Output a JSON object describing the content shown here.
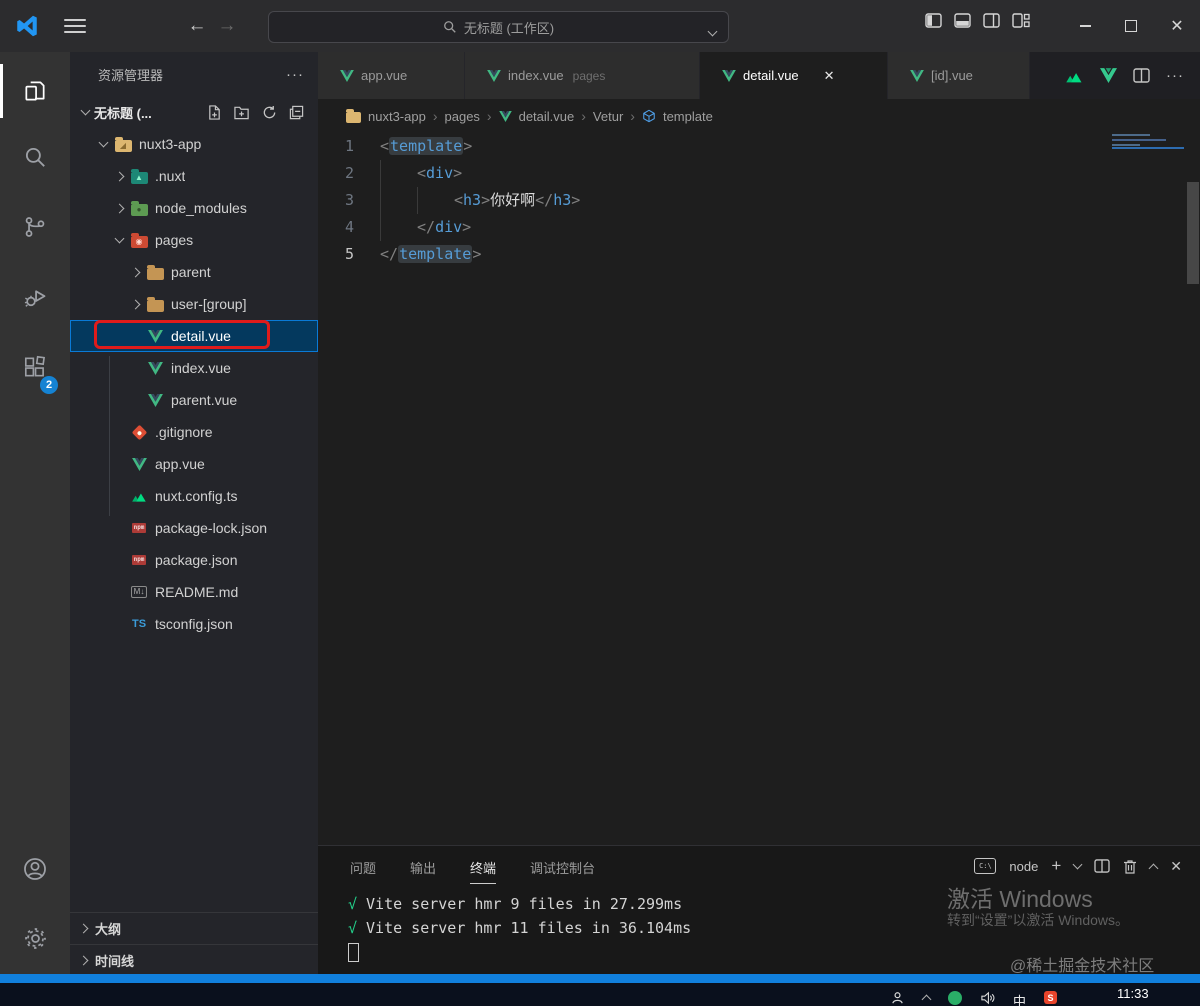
{
  "titlebar": {
    "command_center": "无标题 (工作区)"
  },
  "activity_bar": {
    "badge": "2"
  },
  "sidebar": {
    "title": "资源管理器",
    "more_label": "···",
    "workspace_label": "无标题 (...",
    "outline_label": "大纲",
    "timeline_label": "时间线",
    "tree": [
      {
        "label": "nuxt3-app"
      },
      {
        "label": ".nuxt"
      },
      {
        "label": "node_modules"
      },
      {
        "label": "pages"
      },
      {
        "label": "parent"
      },
      {
        "label": "user-[group]"
      },
      {
        "label": "detail.vue"
      },
      {
        "label": "index.vue"
      },
      {
        "label": "parent.vue"
      },
      {
        "label": ".gitignore"
      },
      {
        "label": "app.vue"
      },
      {
        "label": "nuxt.config.ts"
      },
      {
        "label": "package-lock.json"
      },
      {
        "label": "package.json"
      },
      {
        "label": "README.md"
      },
      {
        "label": "tsconfig.json"
      }
    ]
  },
  "editor": {
    "tabs": [
      {
        "label": "app.vue"
      },
      {
        "label": "index.vue",
        "desc": "pages"
      },
      {
        "label": "detail.vue",
        "close": "✕"
      },
      {
        "label": "[id].vue"
      }
    ],
    "breadcrumb": [
      "nuxt3-app",
      "pages",
      "detail.vue",
      "Vetur",
      "template"
    ],
    "code": {
      "line_numbers": [
        "1",
        "2",
        "3",
        "4",
        "5"
      ],
      "lines": [
        {
          "tokens": [
            {
              "s": "<"
            },
            {
              "s": "template"
            },
            {
              "s": ">"
            }
          ]
        },
        {
          "tokens": [
            {
              "s": "<"
            },
            {
              "s": "div"
            },
            {
              "s": ">"
            }
          ]
        },
        {
          "tokens": [
            {
              "s": "<"
            },
            {
              "s": "h3"
            },
            {
              "s": ">"
            },
            {
              "s": "你好啊"
            },
            {
              "s": "</"
            },
            {
              "s": "h3"
            },
            {
              "s": ">"
            }
          ]
        },
        {
          "tokens": [
            {
              "s": "</"
            },
            {
              "s": "div"
            },
            {
              "s": ">"
            }
          ]
        },
        {
          "tokens": [
            {
              "s": "</"
            },
            {
              "s": "template"
            },
            {
              "s": ">"
            }
          ]
        }
      ]
    }
  },
  "panel": {
    "tabs": [
      "问题",
      "输出",
      "终端",
      "调试控制台"
    ],
    "terminal_profile": "node",
    "terminal_lines": [
      {
        "mark": "√",
        "text": "Vite server hmr 9 files in 27.299ms"
      },
      {
        "mark": "√",
        "text": "Vite server hmr 11 files in 36.104ms"
      }
    ]
  },
  "overlays": {
    "activate_title": "激活 Windows",
    "activate_sub": "转到“设置”以激活 Windows。",
    "social": "@稀土掘金技术社区"
  },
  "taskbar": {
    "time": "11:33",
    "ime": "中"
  },
  "glyphs": {
    "close": "✕",
    "more": "···",
    "plus": "+",
    "cmd": "C:\\"
  },
  "colors": {
    "accent_blue": "#1180dd",
    "selection_blue": "#04395e",
    "annotation_red": "#df1b1b",
    "vue_green": "#41b883",
    "vue_dark": "#35495e",
    "nuxt_green": "#00dc82",
    "npm_red": "#cb3837",
    "ts_blue": "#3b9cd9",
    "badge_blue": "#1583d3",
    "check_green": "#23d18b"
  }
}
